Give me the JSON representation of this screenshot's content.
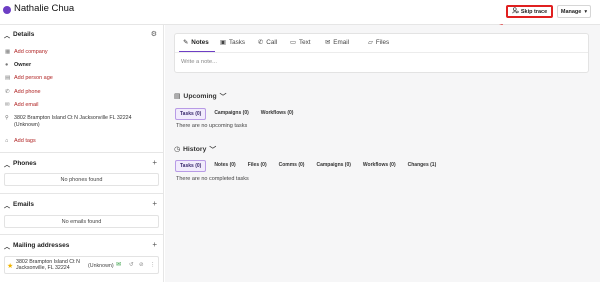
{
  "header": {
    "contact_name": "Nathalie Chua",
    "skip_trace_label": "Skip trace",
    "manage_label": "Manage"
  },
  "sidebar": {
    "details": {
      "title": "Details",
      "add_company": "Add company",
      "role": "Owner",
      "add_person_age": "Add person age",
      "add_phone": "Add phone",
      "add_email": "Add email",
      "address_line": "3802 Brampton Island Ct N Jacksonville FL 32224",
      "address_status": "(Unknown)",
      "add_tags": "Add tags"
    },
    "phones": {
      "title": "Phones",
      "empty": "No phones found"
    },
    "emails": {
      "title": "Emails",
      "empty": "No emails found"
    },
    "mailing": {
      "title": "Mailing addresses",
      "line1": "3802 Brampton Island Ct N",
      "line2": "Jacksonville, FL 32224",
      "status": "(Unknown)"
    }
  },
  "main": {
    "tabs": [
      {
        "label": "Notes"
      },
      {
        "label": "Tasks"
      },
      {
        "label": "Call"
      },
      {
        "label": "Text"
      },
      {
        "label": "Email"
      },
      {
        "label": "Files"
      }
    ],
    "note_placeholder": "Write a note...",
    "upcoming": {
      "title": "Upcoming",
      "filters": [
        "Tasks (0)",
        "Campaigns (0)",
        "Workflows (0)"
      ],
      "empty": "There are no upcoming tasks"
    },
    "history": {
      "title": "History",
      "filters": [
        "Tasks (0)",
        "Notes (0)",
        "Files (0)",
        "Comms (0)",
        "Campaigns (0)",
        "Workflows (0)",
        "Changes (1)"
      ],
      "empty": "There are no completed tasks"
    }
  },
  "colors": {
    "accent": "#6d3ec4",
    "link_red": "#b02424",
    "highlight_red": "#e02020"
  }
}
